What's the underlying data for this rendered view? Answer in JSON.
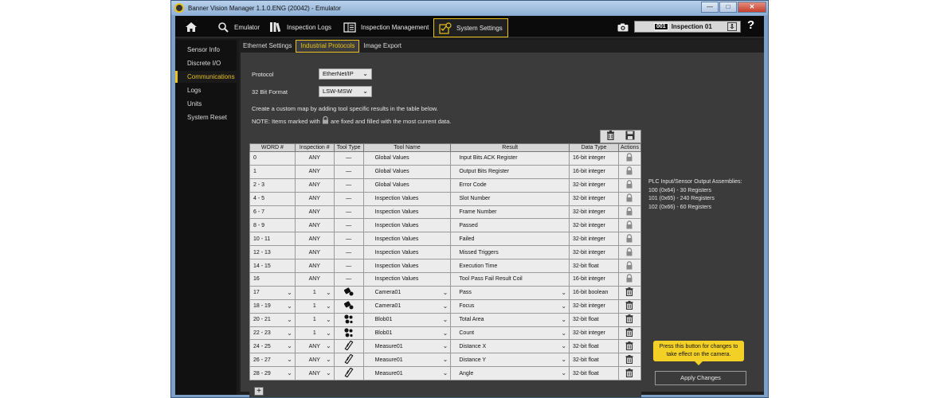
{
  "window": {
    "title": "Banner Vision Manager 1.1.0.ENG (20042) - Emulator",
    "btn_min": "—",
    "btn_max": "□",
    "btn_close": "✕"
  },
  "nav": {
    "tabs": [
      {
        "label": "",
        "icon": "home-icon"
      },
      {
        "label": "Emulator",
        "icon": "emulator-search-icon"
      },
      {
        "label": "Inspection Logs",
        "icon": "logs-icon"
      },
      {
        "label": "Inspection Management",
        "icon": "management-icon"
      },
      {
        "label": "System Settings",
        "icon": "settings-icon"
      }
    ],
    "inspection_num": "001",
    "inspection_name": "Inspection 01",
    "inspection_dd": "⇩",
    "help": "?"
  },
  "sidebar": {
    "items": [
      {
        "label": "Sensor Info"
      },
      {
        "label": "Discrete I/O"
      },
      {
        "label": "Communications"
      },
      {
        "label": "Logs"
      },
      {
        "label": "Units"
      },
      {
        "label": "System Reset"
      }
    ]
  },
  "subtabs": [
    {
      "label": "Ethernet Settings"
    },
    {
      "label": "Industrial Protocols"
    },
    {
      "label": "Image Export"
    }
  ],
  "form": {
    "protocol_label": "Protocol",
    "protocol_value": "EtherNet/IP",
    "format_label": "32 Bit Format",
    "format_value": "LSW-MSW",
    "instructions": "Create a custom map by adding tool specific results in the table below.",
    "note_prefix": "NOTE: Items marked with",
    "note_suffix": "are fixed and filled with the most current data."
  },
  "table": {
    "headers": [
      "WORD #",
      "Inspection #",
      "Tool Type",
      "Tool Name",
      "Result",
      "Data Type",
      "Actions"
    ],
    "rows": [
      {
        "word": "0",
        "insp": "ANY",
        "tooltype": "—",
        "toolname": "Global Values",
        "result": "Input Bits ACK Register",
        "dtype": "16-bit integer",
        "action": "lock",
        "editable": false
      },
      {
        "word": "1",
        "insp": "ANY",
        "tooltype": "—",
        "toolname": "Global Values",
        "result": "Output Bits Register",
        "dtype": "16-bit integer",
        "action": "lock",
        "editable": false
      },
      {
        "word": "2 - 3",
        "insp": "ANY",
        "tooltype": "—",
        "toolname": "Global Values",
        "result": "Error Code",
        "dtype": "32-bit integer",
        "action": "lock",
        "editable": false
      },
      {
        "word": "4 - 5",
        "insp": "ANY",
        "tooltype": "—",
        "toolname": "Inspection Values",
        "result": "Slot Number",
        "dtype": "32-bit integer",
        "action": "lock",
        "editable": false
      },
      {
        "word": "6 - 7",
        "insp": "ANY",
        "tooltype": "—",
        "toolname": "Inspection Values",
        "result": "Frame Number",
        "dtype": "32-bit integer",
        "action": "lock",
        "editable": false
      },
      {
        "word": "8 - 9",
        "insp": "ANY",
        "tooltype": "—",
        "toolname": "Inspection Values",
        "result": "Passed",
        "dtype": "32-bit integer",
        "action": "lock",
        "editable": false
      },
      {
        "word": "10 - 11",
        "insp": "ANY",
        "tooltype": "—",
        "toolname": "Inspection Values",
        "result": "Failed",
        "dtype": "32-bit integer",
        "action": "lock",
        "editable": false
      },
      {
        "word": "12 - 13",
        "insp": "ANY",
        "tooltype": "—",
        "toolname": "Inspection Values",
        "result": "Missed Triggers",
        "dtype": "32-bit integer",
        "action": "lock",
        "editable": false
      },
      {
        "word": "14 - 15",
        "insp": "ANY",
        "tooltype": "—",
        "toolname": "Inspection Values",
        "result": "Execution Time",
        "dtype": "32-bit float",
        "action": "lock",
        "editable": false
      },
      {
        "word": "16",
        "insp": "ANY",
        "tooltype": "—",
        "toolname": "Inspection Values",
        "result": "Tool Pass Fail Result Coil",
        "dtype": "16-bit integer",
        "action": "lock",
        "editable": false
      },
      {
        "word": "17",
        "insp": "1",
        "tooltype": "camera",
        "toolname": "Camera01",
        "result": "Pass",
        "dtype": "16-bit boolean",
        "action": "trash",
        "editable": true
      },
      {
        "word": "18 - 19",
        "insp": "1",
        "tooltype": "camera",
        "toolname": "Camera01",
        "result": "Focus",
        "dtype": "32-bit integer",
        "action": "trash",
        "editable": true
      },
      {
        "word": "20 - 21",
        "insp": "1",
        "tooltype": "blob",
        "toolname": "Blob01",
        "result": "Total Area",
        "dtype": "32-bit float",
        "action": "trash",
        "editable": true
      },
      {
        "word": "22 - 23",
        "insp": "1",
        "tooltype": "blob",
        "toolname": "Blob01",
        "result": "Count",
        "dtype": "32-bit integer",
        "action": "trash",
        "editable": true
      },
      {
        "word": "24 - 25",
        "insp": "ANY",
        "tooltype": "measure",
        "toolname": "Measure01",
        "result": "Distance X",
        "dtype": "32-bit float",
        "action": "trash",
        "editable": true
      },
      {
        "word": "26 - 27",
        "insp": "ANY",
        "tooltype": "measure",
        "toolname": "Measure01",
        "result": "Distance Y",
        "dtype": "32-bit float",
        "action": "trash",
        "editable": true
      },
      {
        "word": "28 - 29",
        "insp": "ANY",
        "tooltype": "measure",
        "toolname": "Measure01",
        "result": "Angle",
        "dtype": "32-bit float",
        "action": "trash",
        "editable": true
      }
    ],
    "add_label": "+"
  },
  "plc": {
    "title": "PLC Input/Sensor Output Assemblies:",
    "lines": [
      "100 (0x64) - 30 Registers",
      "101 (0x65) - 240 Registers",
      "102 (0x66) - 60 Registers"
    ]
  },
  "tooltip": {
    "line1": "Press this button for changes to",
    "line2": "take effect on the camera."
  },
  "apply_label": "Apply Changes",
  "colors": {
    "accent": "#e8c21a",
    "tooltip": "#f2d025"
  }
}
